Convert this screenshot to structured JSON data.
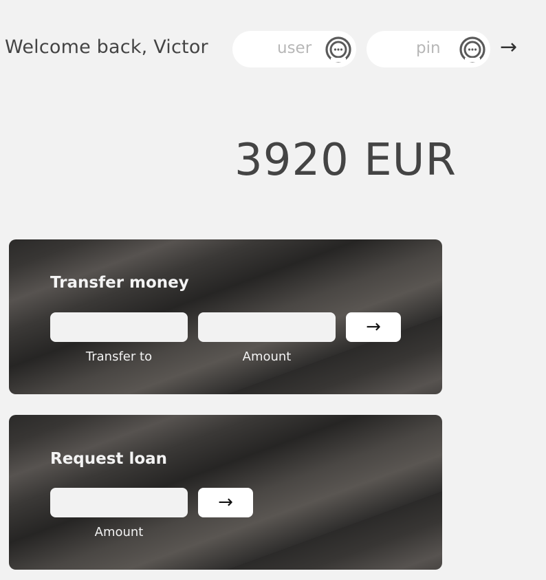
{
  "header": {
    "welcome": "Welcome back, Victor",
    "user_placeholder": "user",
    "pin_placeholder": "pin",
    "login_arrow": "→",
    "field_icon": "chat-bubble-icon"
  },
  "balance": {
    "text": "3920 EUR"
  },
  "transfer": {
    "title": "Transfer money",
    "to_label": "Transfer to",
    "amount_label": "Amount",
    "submit": "→"
  },
  "loan": {
    "title": "Request loan",
    "amount_label": "Amount",
    "submit": "→"
  },
  "colors": {
    "background": "#f2f2f2",
    "card_dark": "#2b2a29",
    "text": "#444444",
    "placeholder": "#b7b7b7"
  }
}
